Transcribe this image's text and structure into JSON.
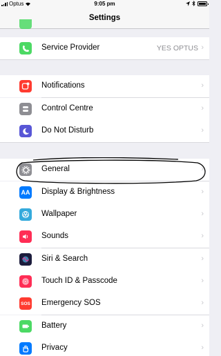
{
  "status_bar": {
    "carrier": "Optus",
    "time": "9:05 pm",
    "battery_level": 0.95
  },
  "nav": {
    "title": "Settings"
  },
  "groups": [
    {
      "items": [
        {
          "label": "Service Provider",
          "detail": "YES OPTUS",
          "icon": "phone-icon",
          "color": "#4cd964"
        }
      ]
    },
    {
      "items": [
        {
          "label": "Notifications",
          "icon": "notifications-icon",
          "color": "#ff3b30"
        },
        {
          "label": "Control Centre",
          "icon": "control-centre-icon",
          "color": "#8e8e93"
        },
        {
          "label": "Do Not Disturb",
          "icon": "moon-icon",
          "color": "#5856d6"
        }
      ]
    },
    {
      "items": [
        {
          "label": "General",
          "icon": "gear-icon",
          "color": "#8e8e93"
        },
        {
          "label": "Display & Brightness",
          "icon": "display-icon",
          "color": "#007aff",
          "glyph": "AA"
        },
        {
          "label": "Wallpaper",
          "icon": "wallpaper-icon",
          "color": "#34aadc"
        },
        {
          "label": "Sounds",
          "icon": "sounds-icon",
          "color": "#ff2d55"
        },
        {
          "label": "Siri & Search",
          "icon": "siri-icon",
          "color": "#1c1c3c"
        },
        {
          "label": "Touch ID & Passcode",
          "icon": "fingerprint-icon",
          "color": "#ff2d55"
        },
        {
          "label": "Emergency SOS",
          "icon": "sos-icon",
          "color": "#ff3b30",
          "glyph": "SOS"
        },
        {
          "label": "Battery",
          "icon": "battery-icon",
          "color": "#4cd964"
        },
        {
          "label": "Privacy",
          "icon": "privacy-icon",
          "color": "#007aff"
        }
      ]
    }
  ],
  "chevron_glyph": "›"
}
